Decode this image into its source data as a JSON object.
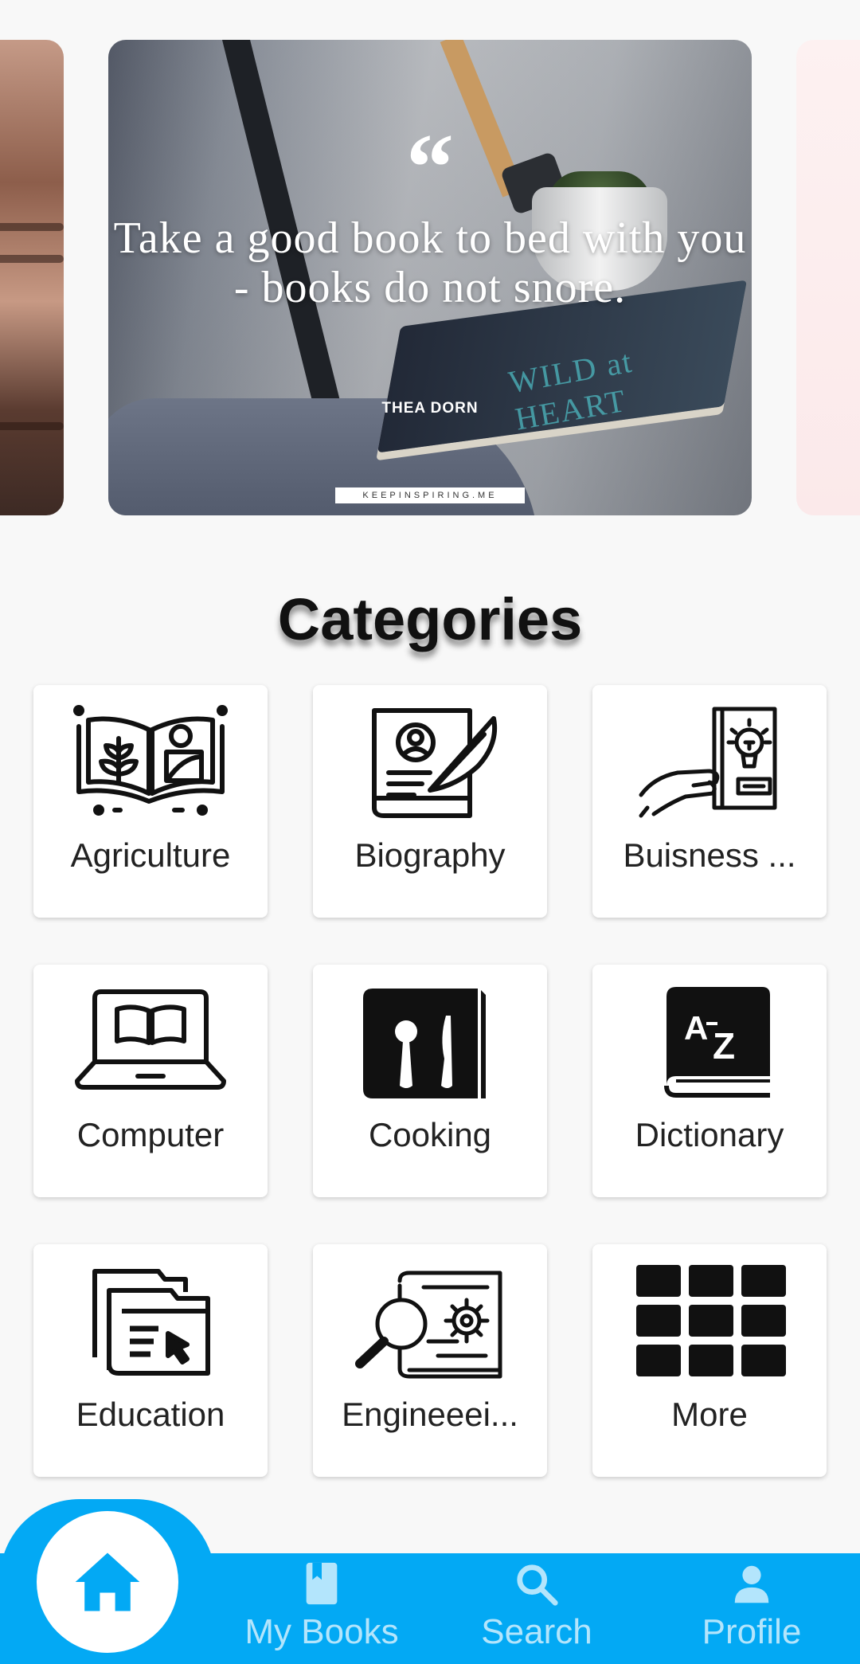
{
  "carousel": {
    "quote_mark": "“",
    "quote_text": "Take a good book to bed with you - books do not snore.",
    "author": "THEA DORN",
    "site": "KEEPINSPIRING.ME",
    "book_cover_text": "WILD at HEART"
  },
  "categories": {
    "title": "Categories",
    "items": [
      {
        "label": "Agriculture",
        "icon": "agriculture-book-icon"
      },
      {
        "label": "Biography",
        "icon": "biography-book-icon"
      },
      {
        "label": "Buisness ...",
        "icon": "business-idea-book-icon"
      },
      {
        "label": "Computer",
        "icon": "laptop-book-icon"
      },
      {
        "label": "Cooking",
        "icon": "cooking-book-icon"
      },
      {
        "label": "Dictionary",
        "icon": "dictionary-az-icon"
      },
      {
        "label": "Education",
        "icon": "education-folders-icon"
      },
      {
        "label": "Engineeei...",
        "icon": "engineering-gear-book-icon"
      },
      {
        "label": "More",
        "icon": "grid-icon"
      }
    ]
  },
  "bottom_nav": {
    "home": {
      "icon": "home-icon"
    },
    "items": [
      {
        "label": "My Books",
        "icon": "bookmark-book-icon"
      },
      {
        "label": "Search",
        "icon": "search-icon"
      },
      {
        "label": "Profile",
        "icon": "person-icon"
      }
    ],
    "colors": {
      "bar": "#03a9f4",
      "inactive": "#b3e5fc",
      "active_fab": "#ffffff"
    }
  }
}
